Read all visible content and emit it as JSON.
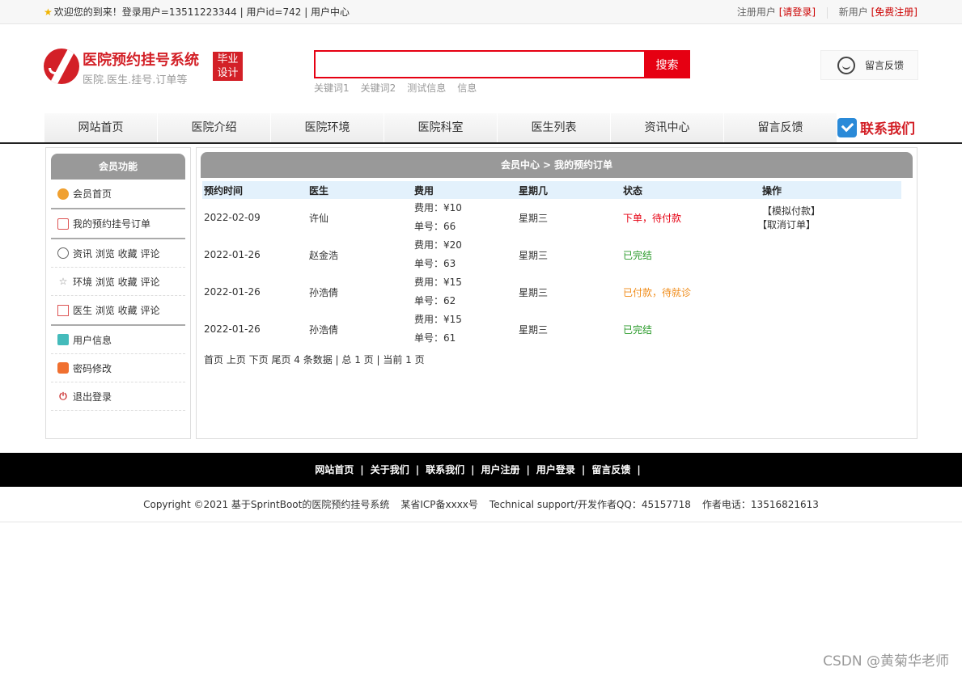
{
  "topbar": {
    "welcome": "欢迎您的到来！登录用户=13511223344 | 用户id=742 | 用户中心",
    "register_label": "注册用户",
    "register_link": "[请登录]",
    "new_user_label": "新用户",
    "new_user_link": "[免费注册]"
  },
  "logo": {
    "title": "医院预约挂号系统",
    "subtitle": "医院.医生.挂号.订单等",
    "badge_line1": "毕业",
    "badge_line2": "设计"
  },
  "search": {
    "button": "搜索",
    "hotwords": [
      "关键词1",
      "关键词2",
      "测试信息",
      "信息"
    ]
  },
  "feedback_button": "留言反馈",
  "nav": {
    "items": [
      "网站首页",
      "医院介绍",
      "医院环境",
      "医院科室",
      "医生列表",
      "资讯中心",
      "留言反馈"
    ],
    "contact": "联系我们"
  },
  "sidebar": {
    "title": "会员功能",
    "items": [
      "会员首页",
      "我的预约挂号订单",
      "资讯 浏览 收藏 评论",
      "环境 浏览 收藏 评论",
      "医生 浏览 收藏 评论",
      "用户信息",
      "密码修改",
      "退出登录"
    ]
  },
  "content": {
    "crumb_root": "会员中心",
    "crumb_sep": ">",
    "crumb_current": "我的预约订单",
    "columns": [
      "预约时间",
      "医生",
      "费用",
      "星期几",
      "状态",
      "操作"
    ],
    "rows": [
      {
        "date": "2022-02-09",
        "doctor": "许仙",
        "fee": "费用：¥10",
        "number": "单号：66",
        "weekday": "星期三",
        "status": "下单，待付款",
        "status_color": "#e60012",
        "op1": "【模拟付款】",
        "op2": "【取消订单】"
      },
      {
        "date": "2022-01-26",
        "doctor": "赵金浩",
        "fee": "费用：¥20",
        "number": "单号：63",
        "weekday": "星期三",
        "status": "已完结",
        "status_color": "#2a9a2a",
        "op1": "",
        "op2": ""
      },
      {
        "date": "2022-01-26",
        "doctor": "孙浩倩",
        "fee": "费用：¥15",
        "number": "单号：62",
        "weekday": "星期三",
        "status": "已付款，待就诊",
        "status_color": "#f08c1a",
        "op1": "",
        "op2": ""
      },
      {
        "date": "2022-01-26",
        "doctor": "孙浩倩",
        "fee": "费用：¥15",
        "number": "单号：61",
        "weekday": "星期三",
        "status": "已完结",
        "status_color": "#2a9a2a",
        "op1": "",
        "op2": ""
      }
    ],
    "pager": "首页 上页 下页 尾页 4 条数据 | 总 1 页 | 当前 1 页"
  },
  "footer": {
    "links": [
      "网站首页",
      "关于我们",
      "联系我们",
      "用户注册",
      "用户登录",
      "留言反馈"
    ],
    "copyright": "Copyright ©2021 基于SprintBoot的医院预约挂号系统",
    "icp": "某省ICP备xxxx号",
    "support": "Technical support/开发作者QQ：45157718",
    "phone": "作者电话：13516821613"
  },
  "watermark": "CSDN @黄菊华老师"
}
